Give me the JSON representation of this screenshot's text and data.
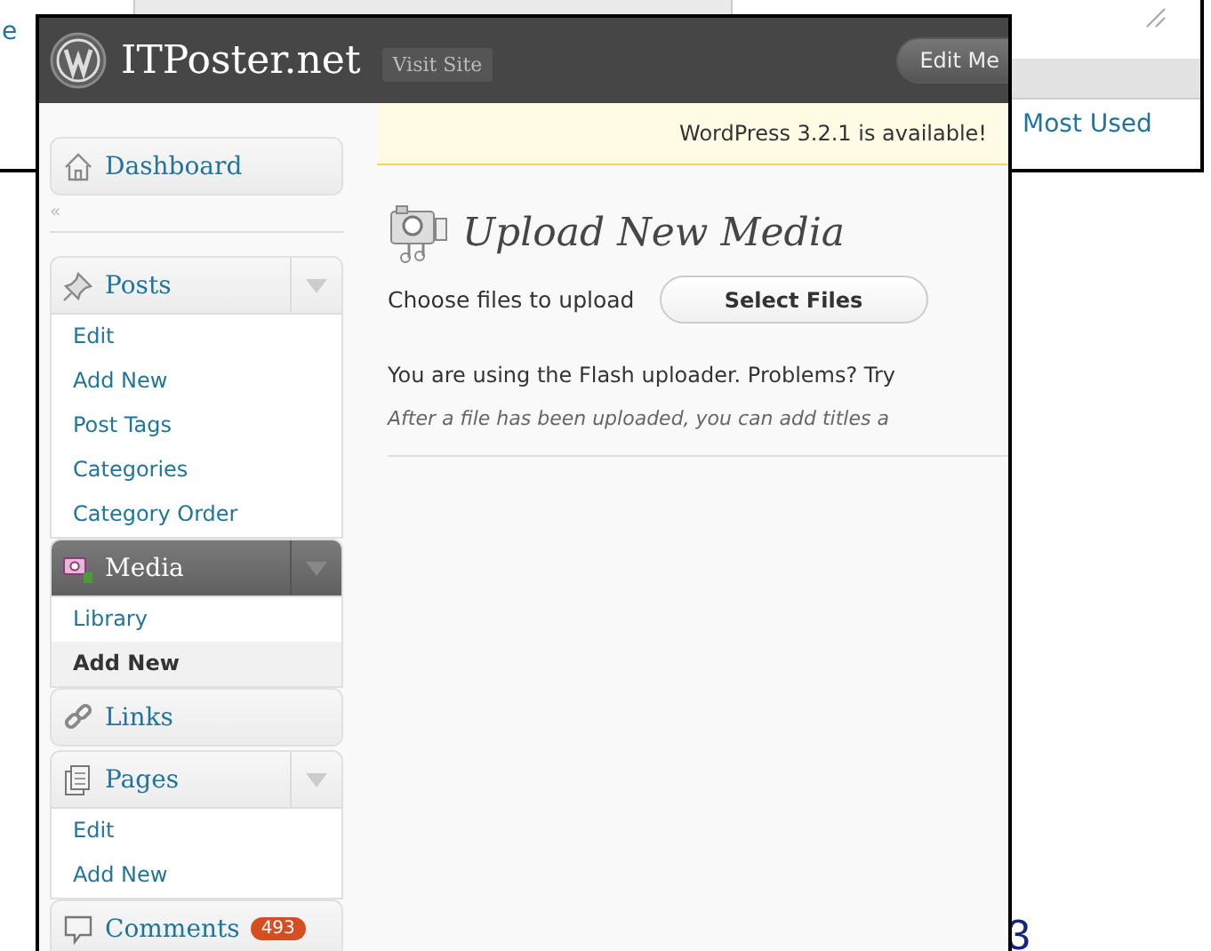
{
  "background_window": {
    "link_fragment": "e",
    "tab": "Most Used",
    "page_fragment": "3"
  },
  "header": {
    "site_title": "ITPoster.net",
    "visit_button": "Visit Site",
    "edit_button": "Edit Me"
  },
  "notice": "WordPress 3.2.1 is available!",
  "menu": [
    {
      "kind": "item",
      "label": "Dashboard",
      "current": false
    },
    {
      "kind": "separator",
      "glyph": "«"
    },
    {
      "kind": "item",
      "label": "Posts",
      "current": false,
      "children": [
        {
          "label": "Edit",
          "selected": false
        },
        {
          "label": "Add New",
          "selected": false
        },
        {
          "label": "Post Tags",
          "selected": false
        },
        {
          "label": "Categories",
          "selected": false
        },
        {
          "label": "Category Order",
          "selected": false
        }
      ]
    },
    {
      "kind": "item",
      "label": "Media",
      "current": true,
      "children": [
        {
          "label": "Library",
          "selected": false
        },
        {
          "label": "Add New",
          "selected": true
        }
      ]
    },
    {
      "kind": "item",
      "label": "Links",
      "current": false
    },
    {
      "kind": "item",
      "label": "Pages",
      "current": false,
      "children": [
        {
          "label": "Edit",
          "selected": false
        },
        {
          "label": "Add New",
          "selected": false
        }
      ]
    },
    {
      "kind": "item",
      "label": "Comments",
      "current": false,
      "badge": "493"
    }
  ],
  "page": {
    "title": "Upload New Media",
    "upload_label": "Choose files to upload",
    "select_button": "Select Files",
    "flash_note": "You are using the Flash uploader. Problems? Try",
    "hint": "After a file has been uploaded, you can add titles a"
  }
}
